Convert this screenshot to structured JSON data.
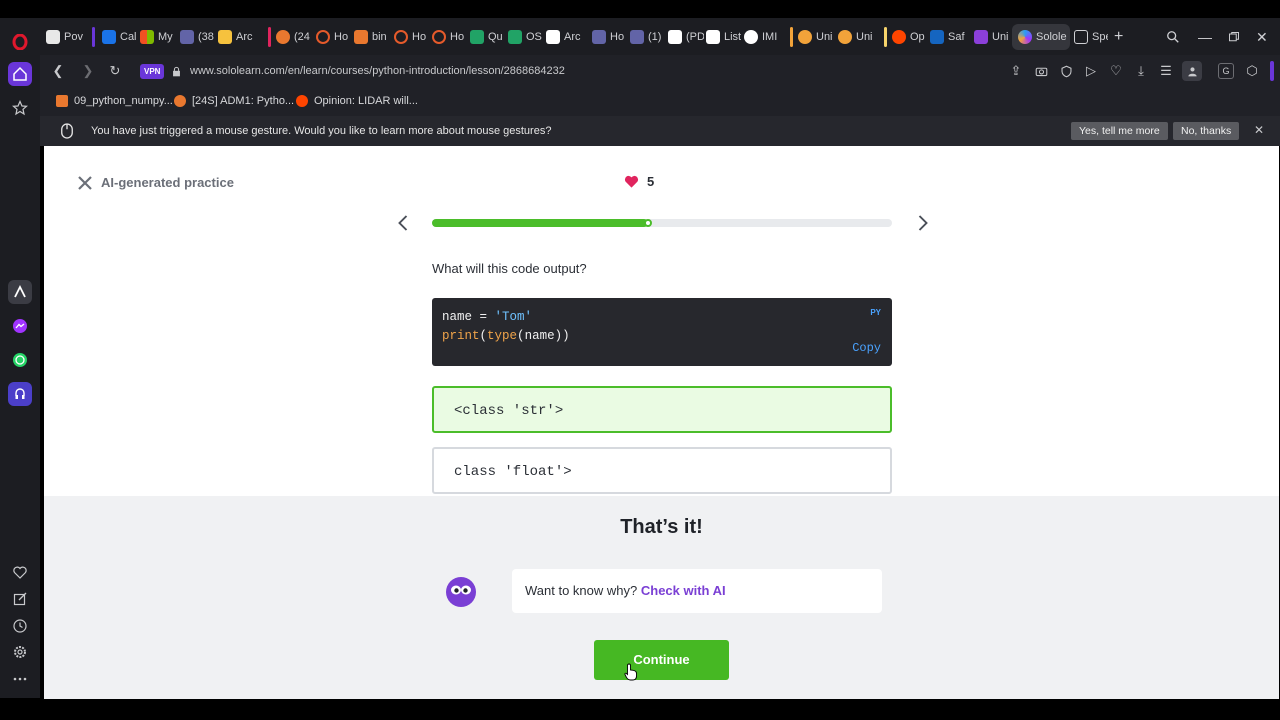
{
  "browser": {
    "tabs": [
      {
        "label": "Pov",
        "color": "#e8e8e8"
      },
      {
        "label": "Cal",
        "color": "#1a73e8"
      },
      {
        "label": "My",
        "color": "#f25022"
      },
      {
        "label": "(38",
        "color": "#6264a7"
      },
      {
        "label": "Arc",
        "color": "#f6c23e"
      },
      {
        "label": "(24",
        "color": "#e9782f"
      },
      {
        "label": "Ho",
        "color": "#e55a2b"
      },
      {
        "label": "bin",
        "color": "#e9782f"
      },
      {
        "label": "Ho",
        "color": "#e55a2b"
      },
      {
        "label": "Ho",
        "color": "#e55a2b"
      },
      {
        "label": "Qu",
        "color": "#21a366"
      },
      {
        "label": "OS",
        "color": "#21a366"
      },
      {
        "label": "Arc",
        "color": "#ffffff"
      },
      {
        "label": "Ho",
        "color": "#6264a7"
      },
      {
        "label": "(1)",
        "color": "#6264a7"
      },
      {
        "label": "(PD",
        "color": "#ffffff"
      },
      {
        "label": "List",
        "color": "#ffffff"
      },
      {
        "label": "IMI",
        "color": "#ffffff"
      },
      {
        "label": "Uni",
        "color": "#f2a33a"
      },
      {
        "label": "Uni",
        "color": "#f2a33a"
      },
      {
        "label": "Op",
        "color": "#ff4500"
      },
      {
        "label": "Saf",
        "color": "#1565c0"
      },
      {
        "label": "Uni",
        "color": "#8b3fd9"
      },
      {
        "label": "Solole",
        "color": "#2a9df4"
      },
      {
        "label": "Spe",
        "color": "#cfd0d4"
      }
    ],
    "url": "www.sololearn.com/en/learn/courses/python-introduction/lesson/2868684232",
    "vpn_label": "VPN",
    "bookmarks": [
      {
        "label": "09_python_numpy...",
        "color": "#e9782f"
      },
      {
        "label": "[24S] ADM1: Pytho...",
        "color": "#e9782f"
      },
      {
        "label": "Opinion: LIDAR will...",
        "color": "#ff4500"
      }
    ],
    "notification": {
      "text": "You have just triggered a mouse gesture. Would you like to learn more about mouse gestures?",
      "accept_label": "Yes, tell me more",
      "decline_label": "No, thanks"
    }
  },
  "lesson": {
    "title": "AI-generated practice",
    "hearts": "5",
    "progress": 0.47,
    "question": "What will this code output?",
    "code": {
      "lang": "PY",
      "copy_label": "Copy",
      "line1": {
        "var": "name",
        "op": " = ",
        "str": "'Tom'"
      },
      "line2": {
        "fn1": "print",
        "p1": "(",
        "fn2": "type",
        "p2": "(",
        "arg": "name",
        "close": "))"
      }
    },
    "options": [
      {
        "text": "<class 'str'>",
        "state": "correct"
      },
      {
        "text": "class 'float'>",
        "state": "default"
      }
    ],
    "feedback": {
      "title": "That’s it!",
      "why_text": "Want to know why? ",
      "why_link": "Check with AI",
      "continue_label": "Continue"
    }
  },
  "colors": {
    "accent_green": "#4bbd2a",
    "link_purple": "#7a3fd4",
    "heart_red": "#e0245e"
  }
}
